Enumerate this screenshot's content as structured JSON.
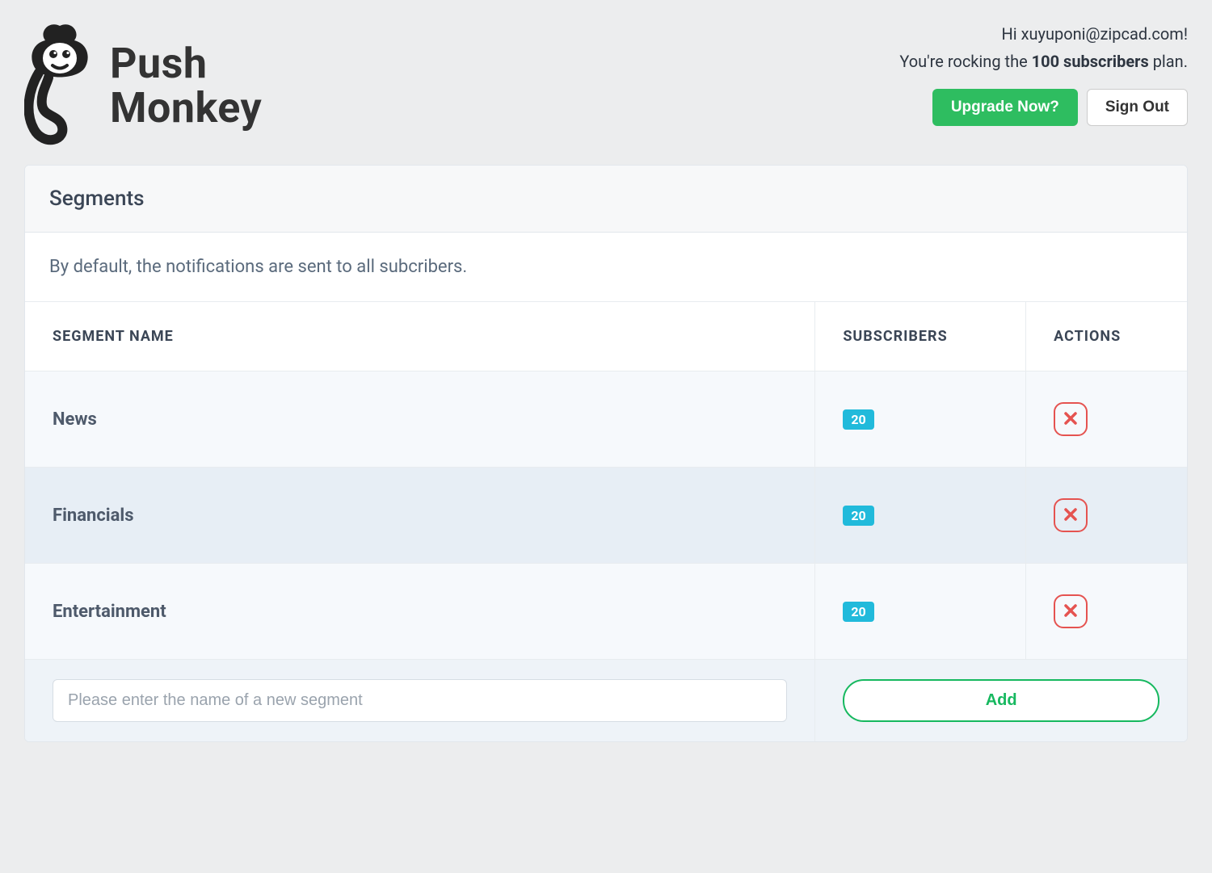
{
  "brand": {
    "line1": "Push",
    "line2": "Monkey"
  },
  "header": {
    "greeting_prefix": "Hi ",
    "greeting_user": "xuyuponi@zipcad.com",
    "greeting_suffix": "!",
    "plan_prefix": "You're rocking the ",
    "plan_bold": "100 subscribers",
    "plan_suffix": " plan.",
    "upgrade_label": "Upgrade Now?",
    "signout_label": "Sign Out"
  },
  "panel": {
    "title": "Segments",
    "hint": "By default, the notifications are sent to all subcribers."
  },
  "table": {
    "headers": {
      "name": "SEGMENT NAME",
      "subs": "SUBSCRIBERS",
      "actions": "ACTIONS"
    },
    "rows": [
      {
        "name": "News",
        "subscribers": "20"
      },
      {
        "name": "Financials",
        "subscribers": "20"
      },
      {
        "name": "Entertainment",
        "subscribers": "20"
      }
    ],
    "new_placeholder": "Please enter the name of a new segment",
    "add_label": "Add"
  }
}
